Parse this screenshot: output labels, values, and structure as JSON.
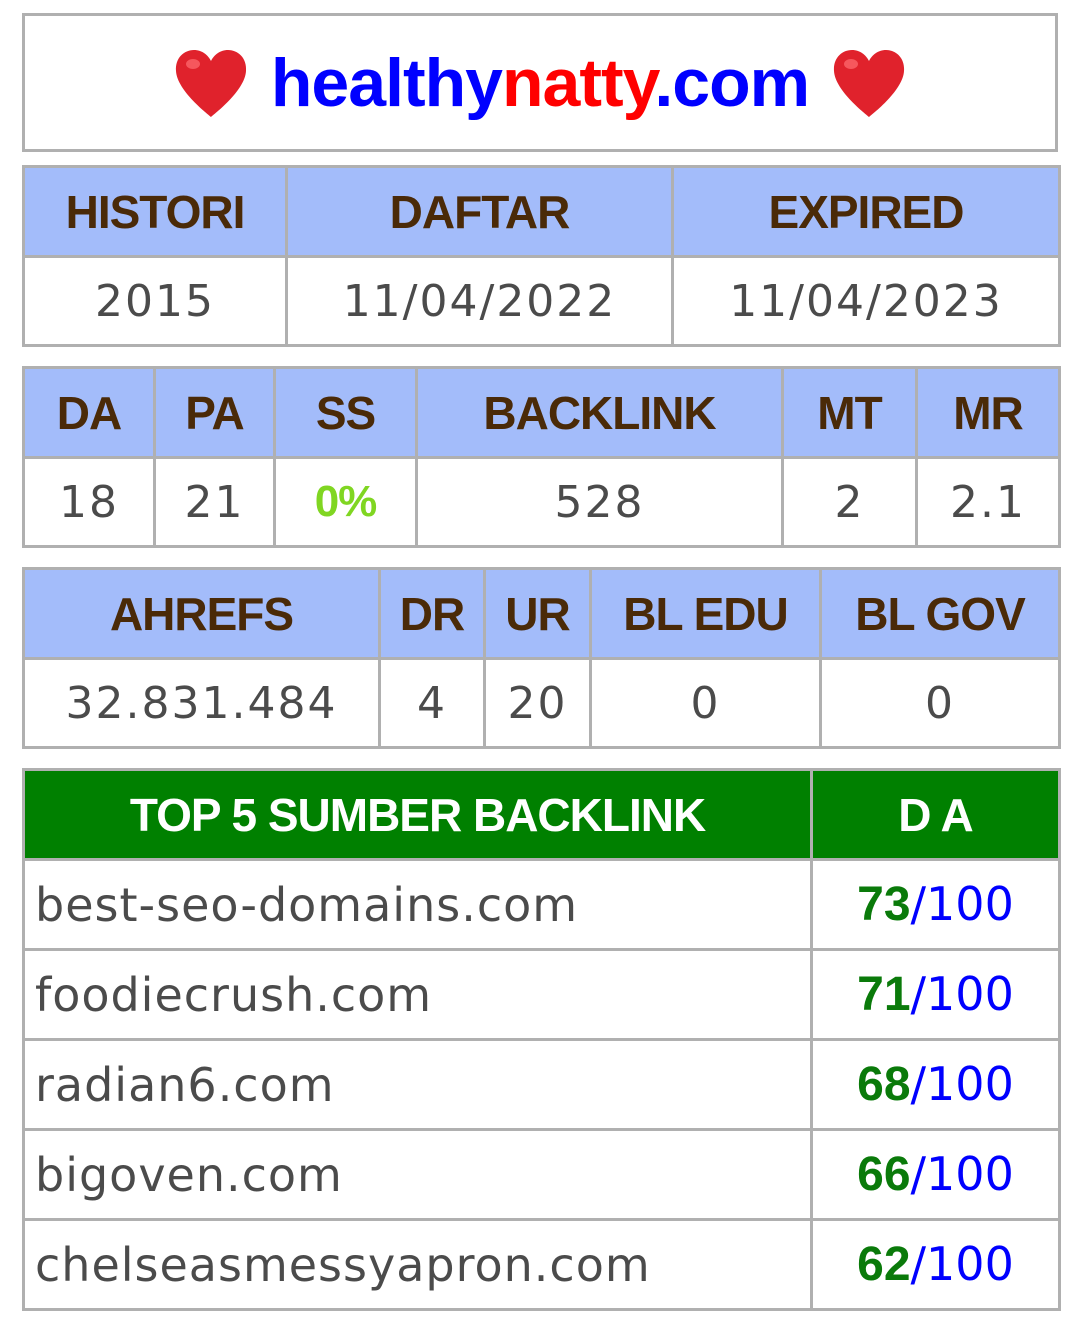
{
  "title": {
    "part1": "healthy",
    "part2": "natty",
    "part3": ".com"
  },
  "colors": {
    "header_bg": "#a3bcfa",
    "header_text": "#4a2a08",
    "green_header": "#008000",
    "ss_value": "#80d622",
    "score": "#0a7a0a",
    "max": "#0000ff"
  },
  "table1": {
    "headers": [
      "HISTORI",
      "DAFTAR",
      "EXPIRED"
    ],
    "values": [
      "2015",
      "11/04/2022",
      "11/04/2023"
    ]
  },
  "table2": {
    "headers": [
      "DA",
      "PA",
      "SS",
      "BACKLINK",
      "MT",
      "MR"
    ],
    "values": [
      "18",
      "21",
      "0%",
      "528",
      "2",
      "2.1"
    ]
  },
  "table3": {
    "headers": [
      "AHREFS",
      "DR",
      "UR",
      "BL EDU",
      "BL GOV"
    ],
    "values": [
      "32.831.484",
      "4",
      "20",
      "0",
      "0"
    ]
  },
  "table4": {
    "headers": [
      "TOP 5 SUMBER BACKLINK",
      "D A"
    ],
    "rows": [
      {
        "site": "best-seo-domains.com",
        "score": "73",
        "max": "100"
      },
      {
        "site": "foodiecrush.com",
        "score": "71",
        "max": "100"
      },
      {
        "site": "radian6.com",
        "score": "68",
        "max": "100"
      },
      {
        "site": "bigoven.com",
        "score": "66",
        "max": "100"
      },
      {
        "site": "chelseasmessyapron.com",
        "score": "62",
        "max": "100"
      }
    ]
  }
}
